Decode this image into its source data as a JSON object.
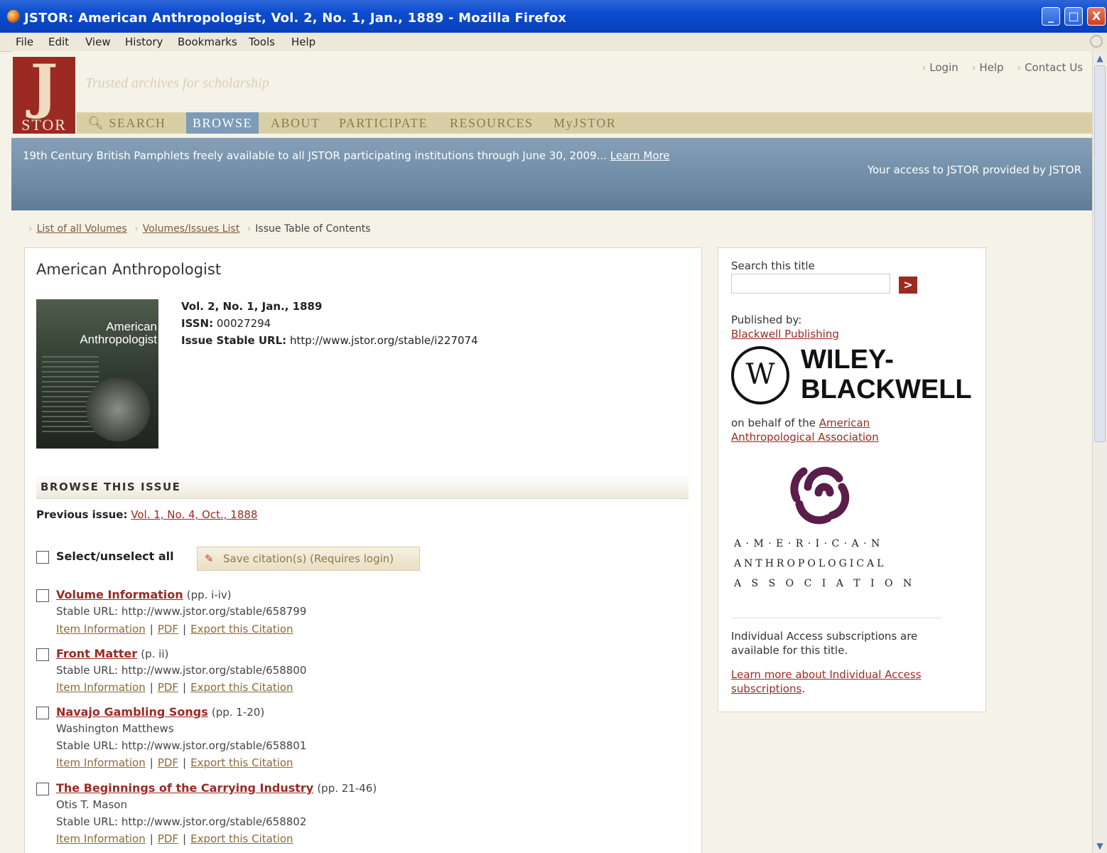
{
  "window": {
    "title": "JSTOR: American Anthropologist, Vol. 2, No. 1, Jan., 1889 - Mozilla Firefox",
    "controls": [
      "_",
      "□",
      "X"
    ]
  },
  "menu": [
    "File",
    "Edit",
    "View",
    "History",
    "Bookmarks",
    "Tools",
    "Help"
  ],
  "header": {
    "logo_letter": "J",
    "logo_text": "STOR",
    "tagline": "Trusted archives for scholarship",
    "top_links": [
      "Login",
      "Help",
      "Contact Us"
    ],
    "nav": [
      "SEARCH",
      "BROWSE",
      "ABOUT",
      "PARTICIPATE",
      "RESOURCES",
      "MyJSTOR"
    ],
    "active_nav": "BROWSE"
  },
  "banner": {
    "message": "19th Century British Pamphlets freely available to all JSTOR participating institutions through June 30, 2009...",
    "learn_more": "Learn More",
    "access": "Your access to JSTOR provided by JSTOR"
  },
  "breadcrumb": [
    "List of all Volumes",
    "Volumes/Issues List",
    "Issue Table of Contents"
  ],
  "journal": {
    "title": "American Anthropologist",
    "cover_title": "American Anthropologist",
    "issue_label": "Vol. 2, No. 1, Jan., 1889",
    "issn_label": "ISSN:",
    "issn": "00027294",
    "stable_url_label": "Issue Stable URL:",
    "stable_url": "http://www.jstor.org/stable/i227074"
  },
  "browse": {
    "heading": "BROWSE THIS ISSUE",
    "previous_label": "Previous issue:",
    "previous_link": "Vol. 1, No. 4, Oct., 1888",
    "select_all": "Select/unselect all",
    "save_citations": "Save citation(s) (Requires login)"
  },
  "articles": [
    {
      "title": "Volume Information",
      "pages": "(pp. i-iv)",
      "author": "",
      "stable_url": "Stable URL: http://www.jstor.org/stable/658799"
    },
    {
      "title": "Front Matter",
      "pages": "(p. ii)",
      "author": "",
      "stable_url": "Stable URL: http://www.jstor.org/stable/658800"
    },
    {
      "title": "Navajo Gambling Songs",
      "pages": "(pp. 1-20)",
      "author": "Washington Matthews",
      "stable_url": "Stable URL: http://www.jstor.org/stable/658801"
    },
    {
      "title": "The Beginnings of the Carrying Industry",
      "pages": "(pp. 21-46)",
      "author": "Otis T. Mason",
      "stable_url": "Stable URL: http://www.jstor.org/stable/658802"
    }
  ],
  "article_links": {
    "info": "Item Information",
    "pdf": "PDF",
    "export": "Export this Citation"
  },
  "sidebar": {
    "search_label": "Search this title",
    "search_value": "",
    "search_button": ">",
    "published_by": "Published by:",
    "publisher": "Blackwell Publishing",
    "wiley_line1": "WILEY-",
    "wiley_line2": "BLACKWELL",
    "on_behalf": "on behalf of the",
    "association": "American Anthropological Association",
    "aaa_line1": "A · M · E · R · I · C · A · N",
    "aaa_line2": "ANTHROPOLOGICAL",
    "aaa_line3": "A S S O C I A T I O N",
    "subscription_note": "Individual Access subscriptions are available for this title.",
    "learn_more_link": "Learn more about Individual Access subscriptions",
    "period": "."
  },
  "colors": {
    "accent": "#9b2a23",
    "banner": "#7490aa",
    "nav": "#d9cfa6",
    "active_nav": "#7e9bb7"
  }
}
